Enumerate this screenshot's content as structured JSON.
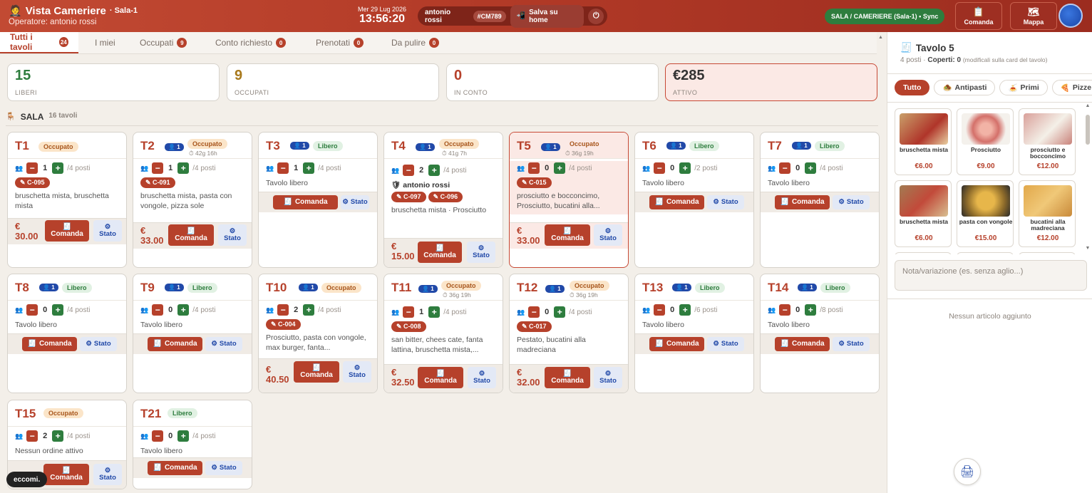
{
  "header": {
    "app_title": "Vista Cameriere",
    "app_subtitle": "Sala-1",
    "operator": "Operatore: antonio rossi",
    "date": "Mer 29 Lug 2026",
    "time": "13:56:20",
    "user_name": "antonio rossi",
    "user_code": "#CM789",
    "save_home": "Salva su home",
    "sync": "SALA / CAMERIERE (Sala-1) • Sync",
    "comanda": "Comanda",
    "mappa": "Mappa"
  },
  "tabs": [
    {
      "label": "Tutti i tavoli",
      "count": "24"
    },
    {
      "label": "I miei",
      "count": ""
    },
    {
      "label": "Occupati",
      "count": "9"
    },
    {
      "label": "Conto richiesto",
      "count": "0"
    },
    {
      "label": "Prenotati",
      "count": "0"
    },
    {
      "label": "Da pulire",
      "count": "0"
    }
  ],
  "stats": [
    {
      "value": "15",
      "label": "LIBERI",
      "color": "#2e7d3e"
    },
    {
      "value": "9",
      "label": "OCCUPATI",
      "color": "#a8791c"
    },
    {
      "value": "0",
      "label": "IN CONTO",
      "color": "#b6412b"
    },
    {
      "value": "€285",
      "label": "ATTIVO",
      "color": "#333333"
    }
  ],
  "section": {
    "title": "SALA",
    "subtitle": "16 tavoli"
  },
  "labels": {
    "comanda": "Comanda",
    "stato": "Stato"
  },
  "tables": {
    "t1": {
      "name": "T1",
      "status": "Occupato",
      "covers": "1",
      "max": "/4 posti",
      "orders": [
        "C-095"
      ],
      "items": "bruschetta mista, bruschetta mista",
      "total_a": "€",
      "total_b": "30.00"
    },
    "t2": {
      "name": "T2",
      "badge": "1",
      "status": "Occupato",
      "timer": "⏱ 42g 16h",
      "covers": "1",
      "max": "/4 posti",
      "orders": [
        "C-091"
      ],
      "items": "bruschetta mista, pasta con vongole, pizza sole",
      "total_a": "€",
      "total_b": "33.00"
    },
    "t3": {
      "name": "T3",
      "badge": "1",
      "status": "Libero",
      "covers": "1",
      "max": "/4 posti",
      "items": "Tavolo libero"
    },
    "t4": {
      "name": "T4",
      "badge": "1",
      "status": "Occupato",
      "timer": "⏱ 41g 7h",
      "covers": "2",
      "max": "/4 posti",
      "user": "antonio rossi",
      "orders": [
        "C-097",
        "C-096"
      ],
      "items": "bruschetta mista · Prosciutto",
      "total_a": "€",
      "total_b": "15.00"
    },
    "t5": {
      "name": "T5",
      "badge": "1",
      "status": "Occupato",
      "timer": "⏱ 36g 19h",
      "covers": "0",
      "max": "/4 posti",
      "orders": [
        "C-015"
      ],
      "items": "prosciutto e bocconcimo, Prosciutto, bucatini alla...",
      "total_a": "€",
      "total_b": "33.00"
    },
    "t6": {
      "name": "T6",
      "badge": "1",
      "status": "Libero",
      "covers": "0",
      "max": "/2 posti",
      "items": "Tavolo libero"
    },
    "t7": {
      "name": "T7",
      "badge": "1",
      "status": "Libero",
      "covers": "0",
      "max": "/4 posti",
      "items": "Tavolo libero"
    },
    "t8": {
      "name": "T8",
      "badge": "1",
      "status": "Libero",
      "covers": "0",
      "max": "/4 posti",
      "items": "Tavolo libero"
    },
    "t9": {
      "name": "T9",
      "badge": "1",
      "status": "Libero",
      "covers": "0",
      "max": "/4 posti",
      "items": "Tavolo libero"
    },
    "t10": {
      "name": "T10",
      "badge": "1",
      "status": "Occupato",
      "covers": "2",
      "max": "/4 posti",
      "orders": [
        "C-004"
      ],
      "items": "Prosciutto, pasta con vongole, max burger, fanta...",
      "total_a": "€",
      "total_b": "40.50"
    },
    "t11": {
      "name": "T11",
      "badge": "1",
      "status": "Occupato",
      "timer": "⏱ 36g 19h",
      "covers": "1",
      "max": "/4 posti",
      "orders": [
        "C-008"
      ],
      "items": "san bitter, chees cate, fanta lattina, bruschetta mista,...",
      "total_a": "€",
      "total_b": "32.50"
    },
    "t12": {
      "name": "T12",
      "badge": "1",
      "status": "Occupato",
      "timer": "⏱ 36g 19h",
      "covers": "0",
      "max": "/4 posti",
      "orders": [
        "C-017"
      ],
      "items": "Pestato, bucatini alla madreciana",
      "total_a": "€",
      "total_b": "32.00"
    },
    "t13": {
      "name": "T13",
      "badge": "1",
      "status": "Libero",
      "covers": "0",
      "max": "/6 posti",
      "items": "Tavolo libero"
    },
    "t14": {
      "name": "T14",
      "badge": "1",
      "status": "Libero",
      "covers": "0",
      "max": "/8 posti",
      "items": "Tavolo libero"
    },
    "t15": {
      "name": "T15",
      "status": "Occupato",
      "covers": "2",
      "max": "/4 posti",
      "items": "Nessun ordine attivo"
    },
    "t21": {
      "name": "T21",
      "status": "Libero",
      "covers": "0",
      "max": "/4 posti",
      "items": "Tavolo libero"
    }
  },
  "panel": {
    "title": "Tavolo 5",
    "posti": "4 posti",
    "coperti_label": "Coperti:",
    "coperti_value": "0",
    "coperti_note": "(modificali sulla card del tavolo)",
    "categories": [
      {
        "label": "Tutto",
        "icon": ""
      },
      {
        "label": "Antipasti",
        "icon": "🧆"
      },
      {
        "label": "Primi",
        "icon": "🍝"
      },
      {
        "label": "Pizze",
        "icon": "🍕"
      }
    ],
    "products": [
      {
        "name": "bruschetta mista",
        "price": "€6.00"
      },
      {
        "name": "Prosciutto",
        "price": "€9.00"
      },
      {
        "name": "prosciutto e bocconcimo",
        "price": "€12.00"
      },
      {
        "name": "bruschetta mista",
        "price": "€6.00"
      },
      {
        "name": "pasta con vongole",
        "price": "€15.00"
      },
      {
        "name": "bucatini alla madreciana",
        "price": "€12.00"
      }
    ],
    "note_placeholder": "Nota/variazione (es. senza aglio...)",
    "empty": "Nessun articolo aggiunto"
  },
  "footer_badge": "eccomi."
}
